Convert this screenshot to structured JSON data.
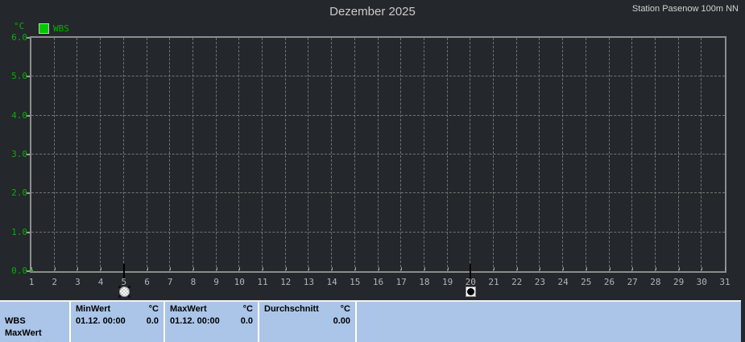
{
  "header": {
    "title": "Dezember 2025",
    "station": "Station Pasenow 100m NN"
  },
  "chart": {
    "unit_label": "°C",
    "legend": [
      {
        "label": "WBS",
        "color": "#00c800"
      }
    ],
    "y_ticks": [
      "6.0",
      "5.0",
      "4.0",
      "3.0",
      "2.0",
      "1.0",
      "0.0"
    ],
    "x_ticks": [
      "1",
      "2",
      "3",
      "4",
      "5",
      "6",
      "7",
      "8",
      "9",
      "10",
      "11",
      "12",
      "13",
      "14",
      "15",
      "16",
      "17",
      "18",
      "19",
      "20",
      "21",
      "22",
      "23",
      "24",
      "25",
      "26",
      "27",
      "28",
      "29",
      "30",
      "31"
    ],
    "markers": [
      {
        "day": 5,
        "shape": "circle-hatched",
        "name": "range-marker-start"
      },
      {
        "day": 20,
        "shape": "square-dot",
        "name": "range-marker-end"
      }
    ]
  },
  "chart_data": {
    "type": "line",
    "title": "Dezember 2025",
    "ylabel": "°C",
    "ylim": [
      0.0,
      6.0
    ],
    "x_range_days": [
      1,
      31
    ],
    "grid": true,
    "legend_position": "top-left",
    "series": [
      {
        "name": "WBS",
        "color": "#00c800",
        "points": [
          {
            "x": "01.12. 00:00",
            "y": 0.0
          }
        ]
      }
    ],
    "stats": {
      "min": {
        "date": "01.12. 00:00",
        "value": 0.0
      },
      "max": {
        "date": "01.12. 00:00",
        "value": 0.0
      },
      "average": 0.0
    }
  },
  "stats_table": {
    "row_labels": [
      "WBS",
      "MaxWert"
    ],
    "columns": [
      {
        "header": "MinWert",
        "unit": "°C",
        "date": "01.12. 00:00",
        "value": "0.0"
      },
      {
        "header": "MaxWert",
        "unit": "°C",
        "date": "01.12. 00:00",
        "value": "0.0"
      },
      {
        "header": "Durchschnitt",
        "unit": "°C",
        "date": "",
        "value": "0.00"
      }
    ]
  },
  "colors": {
    "background": "#24272b",
    "axis": "#8d8d8d",
    "grid": "#737373",
    "green_text": "#00b400",
    "series_green": "#00c800",
    "x_label": "#b4b4b4",
    "title_text": "#cbcbcb",
    "table_background": "#abc5e8",
    "table_text": "#000000",
    "table_separator": "#ffffff"
  }
}
